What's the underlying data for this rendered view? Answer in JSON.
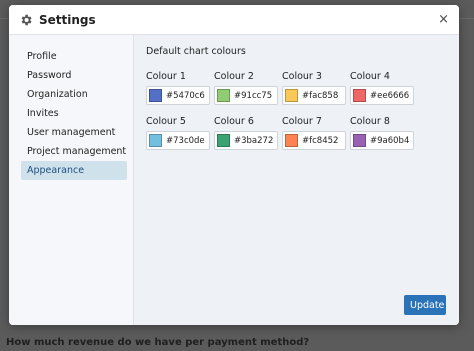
{
  "dialog": {
    "title": "Settings",
    "close_glyph": "×",
    "gear_icon": "gear-icon"
  },
  "sidebar": {
    "items": [
      {
        "label": "Profile",
        "active": false
      },
      {
        "label": "Password",
        "active": false
      },
      {
        "label": "Organization",
        "active": false
      },
      {
        "label": "Invites",
        "active": false
      },
      {
        "label": "User management",
        "active": false
      },
      {
        "label": "Project management",
        "active": false
      },
      {
        "label": "Appearance",
        "active": true
      }
    ]
  },
  "appearance": {
    "section_title": "Default chart colours",
    "colours": [
      {
        "label": "Colour 1",
        "value": "#5470c6"
      },
      {
        "label": "Colour 2",
        "value": "#91cc75"
      },
      {
        "label": "Colour 3",
        "value": "#fac858"
      },
      {
        "label": "Colour 4",
        "value": "#ee6666"
      },
      {
        "label": "Colour 5",
        "value": "#73c0de"
      },
      {
        "label": "Colour 6",
        "value": "#3ba272"
      },
      {
        "label": "Colour 7",
        "value": "#fc8452"
      },
      {
        "label": "Colour 8",
        "value": "#9a60b4"
      }
    ],
    "update_label": "Update"
  },
  "background": {
    "question": "How much revenue do we have per payment method?"
  },
  "colors": {
    "accent": "#2b73b8",
    "active_nav_bg": "#cfe2ec"
  }
}
